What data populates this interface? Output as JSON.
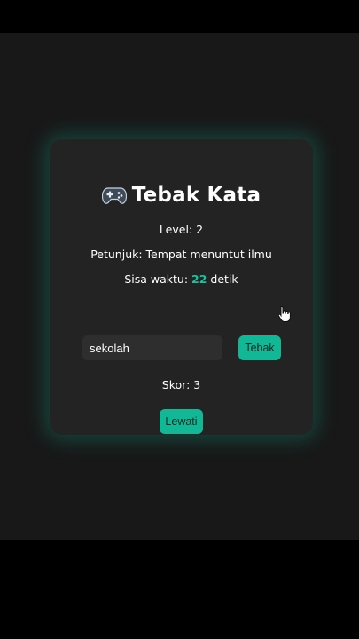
{
  "game": {
    "title_icon": "game-controller-icon",
    "title": "Tebak Kata",
    "level_text": "Level: 2",
    "hint_text": "Petunjuk: Tempat menuntut ilmu",
    "timer_prefix": "Sisa waktu: ",
    "timer_value": "22",
    "timer_suffix": " detik",
    "input_value": "sekolah",
    "guess_button_label": "Tebak",
    "score_text": "Skor: 3",
    "skip_button_label": "Lewati"
  },
  "colors": {
    "accent": "#12b896",
    "page_background": "#181818",
    "card_background": "#232323",
    "input_background": "#2e2e2e"
  },
  "cursor": {
    "icon": "hand-pointer-icon"
  }
}
